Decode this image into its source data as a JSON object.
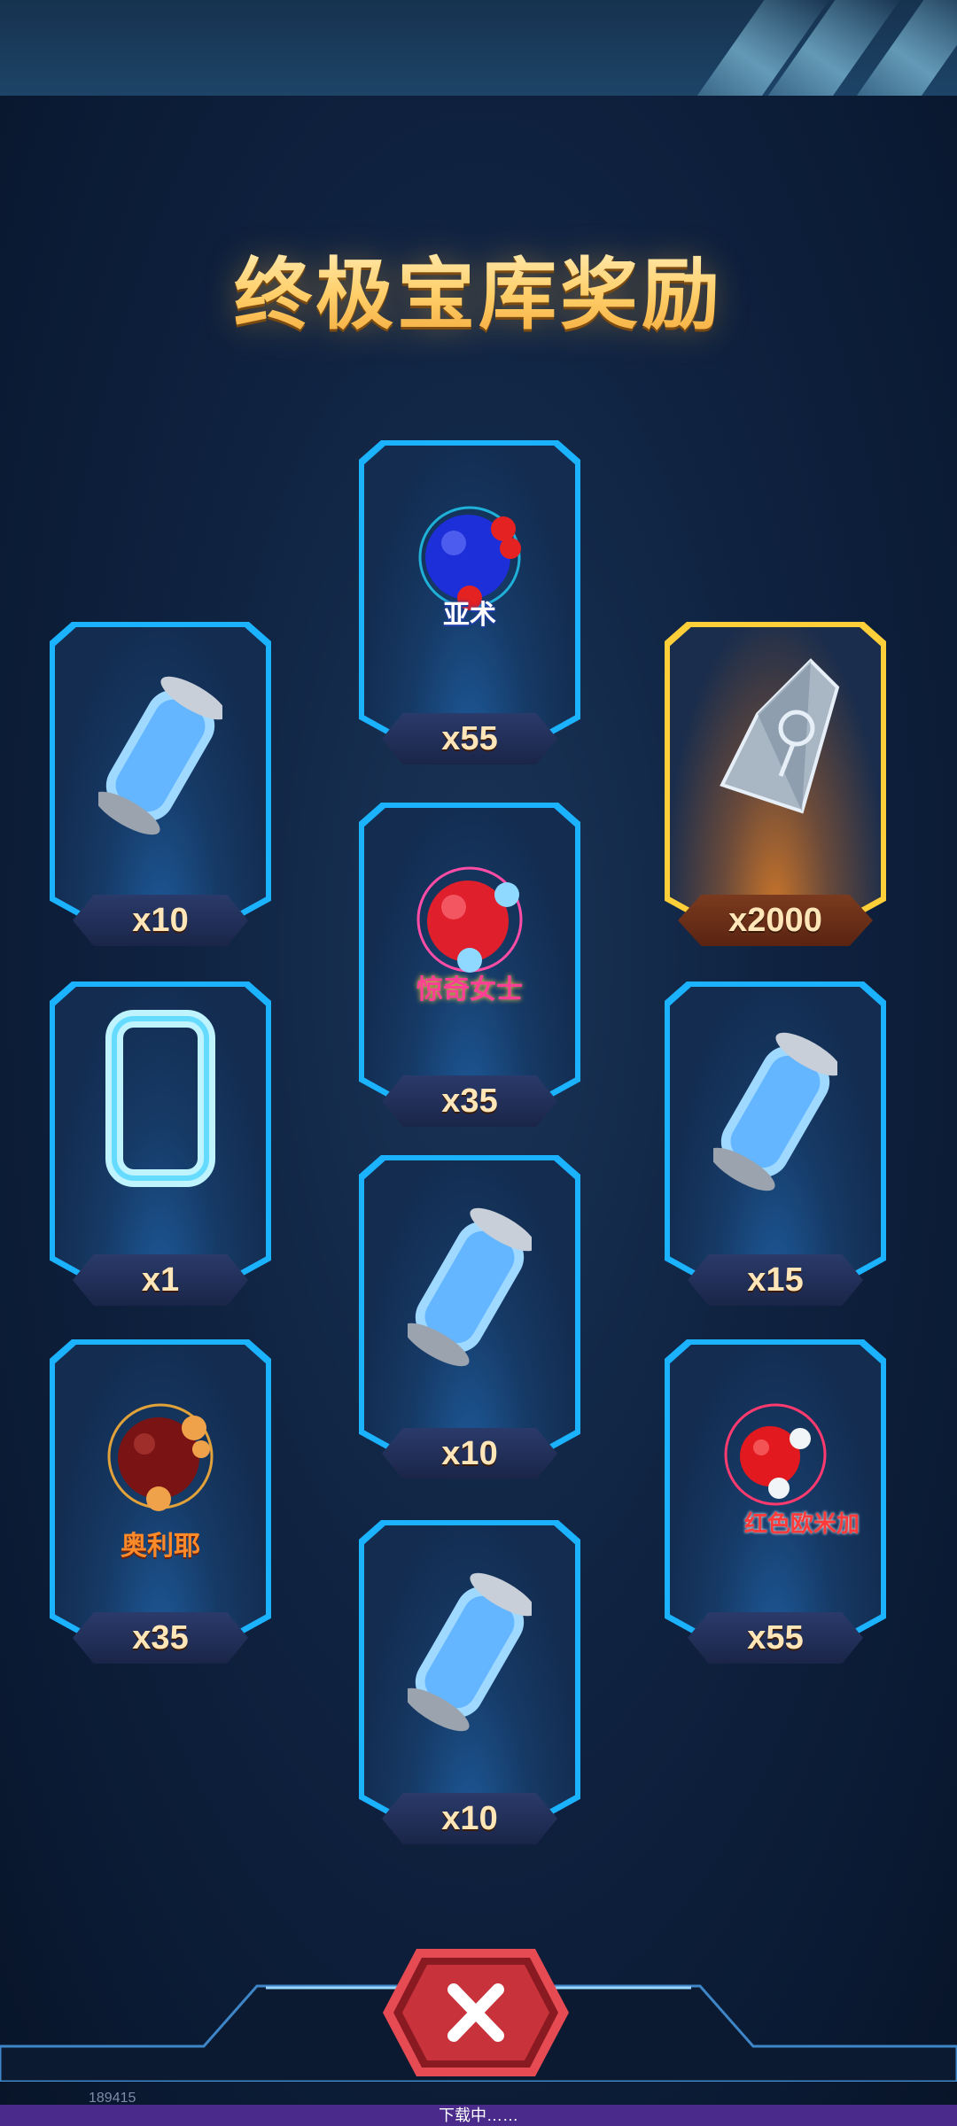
{
  "title": "终极宝库奖励",
  "rewards": [
    {
      "item": "blue-atom-ball",
      "label": "亚术",
      "quantity": "x55"
    },
    {
      "item": "energy-canister",
      "label": "",
      "quantity": "x10"
    },
    {
      "item": "silver-shard",
      "label": "",
      "quantity": "x2000"
    },
    {
      "item": "red-atom-ball",
      "label": "惊奇女士",
      "quantity": "x35"
    },
    {
      "item": "crystal-frame",
      "label": "",
      "quantity": "x1"
    },
    {
      "item": "energy-canister",
      "label": "",
      "quantity": "x15"
    },
    {
      "item": "energy-canister",
      "label": "",
      "quantity": "x10"
    },
    {
      "item": "dark-red-atom-ball",
      "label": "奥利耶",
      "quantity": "x35"
    },
    {
      "item": "red-atom-ball-small",
      "label": "红色欧米加",
      "quantity": "x55"
    },
    {
      "item": "energy-canister",
      "label": "",
      "quantity": "x10"
    }
  ],
  "close_icon": "close-icon",
  "status_text": "下载中……",
  "build_number": "189415",
  "colors": {
    "frame_blue": "#1bb3ff",
    "frame_gold": "#ffcf3a",
    "title_gold": "#ffcf6a",
    "close_red": "#c8323a"
  }
}
